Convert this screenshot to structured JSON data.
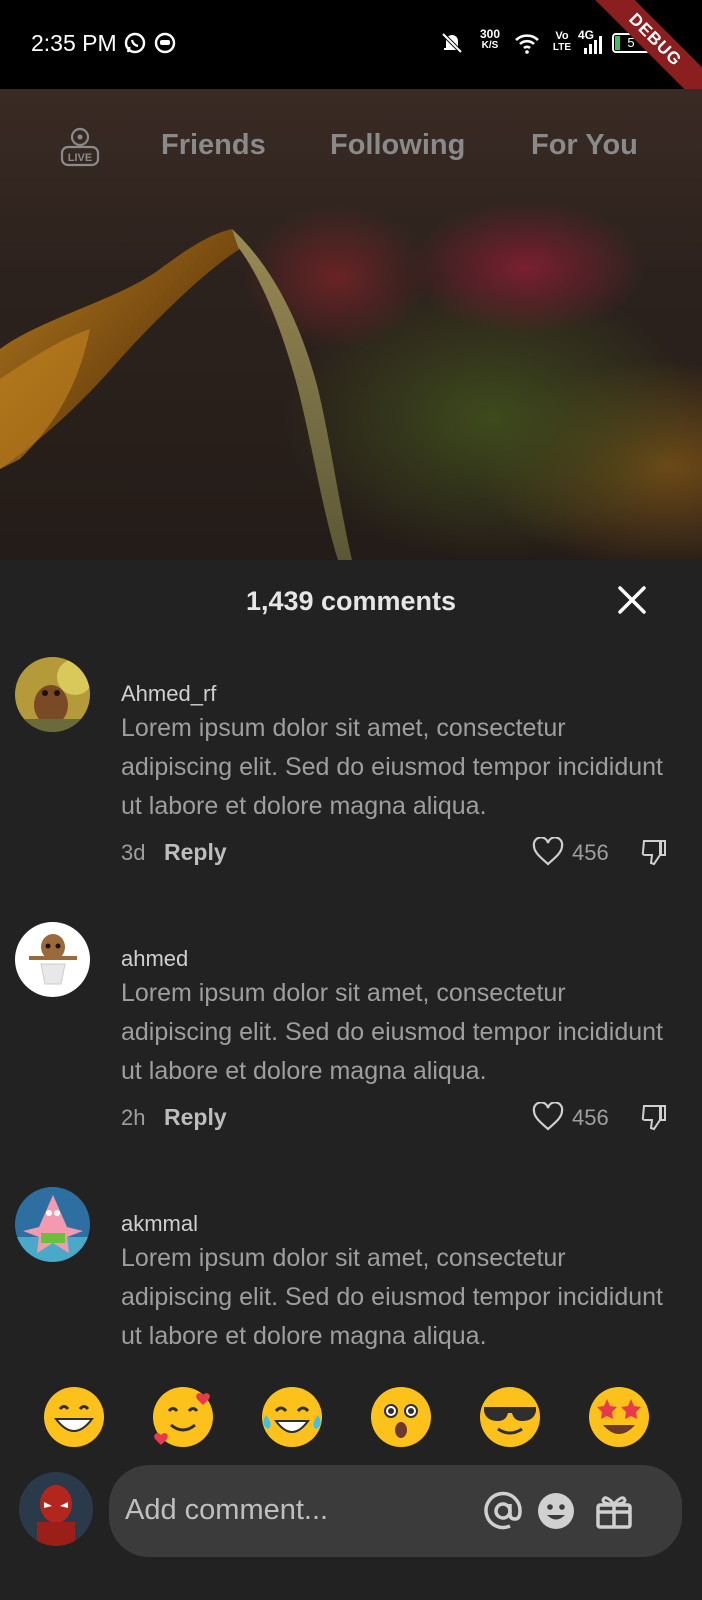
{
  "status_bar": {
    "time": "2:35 PM",
    "speed_value": "300",
    "speed_unit": "K/S",
    "vo_top": "Vo",
    "vo_bottom": "LTE",
    "network": "4G",
    "battery": "5",
    "debug_label": "DEBUG"
  },
  "top_nav": {
    "live_label": "LIVE",
    "tabs": [
      "Friends",
      "Following",
      "For You"
    ]
  },
  "comments_sheet": {
    "title": "1,439 comments",
    "comments": [
      {
        "user": "Ahmed_rf",
        "text": "Lorem ipsum dolor sit amet, consectetur adipiscing elit. Sed do eiusmod tempor incididunt ut labore et dolore magna aliqua.",
        "time": "3d",
        "reply_label": "Reply",
        "likes": "456"
      },
      {
        "user": "ahmed",
        "text": "Lorem ipsum dolor sit amet, consectetur adipiscing elit. Sed do eiusmod tempor incididunt ut labore et dolore magna aliqua.",
        "time": "2h",
        "reply_label": "Reply",
        "likes": "456"
      },
      {
        "user": "akmmal",
        "text": "Lorem ipsum dolor sit amet, consectetur adipiscing elit. Sed do eiusmod tempor incididunt ut labore et dolore magna aliqua.",
        "time": "",
        "reply_label": "",
        "likes": ""
      }
    ]
  },
  "emoji_bar": [
    "grinning-face",
    "smiling-face-with-hearts",
    "tears-of-joy",
    "astonished-face",
    "sunglasses-face",
    "star-struck"
  ],
  "input_bar": {
    "placeholder": "Add comment...",
    "icons": [
      "at-icon",
      "emoji-icon",
      "gift-icon"
    ]
  },
  "colors": {
    "sheet_bg": "#222222",
    "input_bg": "#3b3b3b",
    "text_primary": "#e6e6e6",
    "text_secondary": "#9e9e9e",
    "debug_ribbon": "#8b1e1e"
  }
}
